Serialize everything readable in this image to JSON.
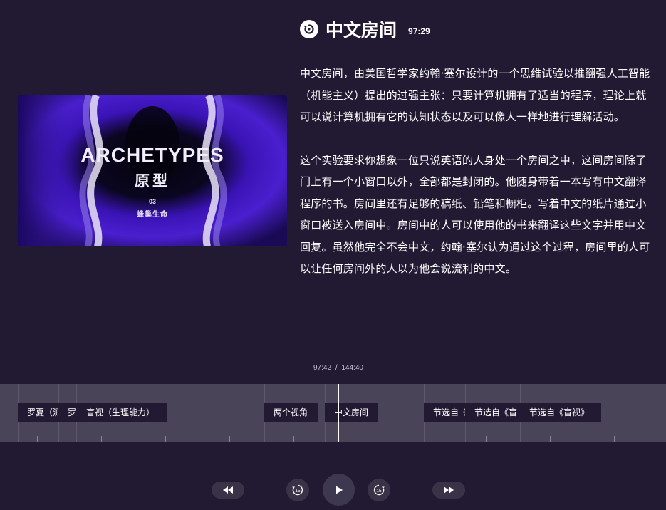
{
  "cover": {
    "title": "ARCHETYPES",
    "subtitle": "原型",
    "number": "03",
    "name": "蜂巢生命"
  },
  "header": {
    "title": "中文房间",
    "time": "97:29",
    "icon": "replay-icon"
  },
  "description": {
    "paragraph1": "中文房间，由美国哲学家约翰·塞尔设计的一个思维试验以推翻强人工智能（机能主义）提出的过强主张：只要计算机拥有了适当的程序，理论上就可以说计算机拥有它的认知状态以及可以像人一样地进行理解活动。",
    "paragraph2": "这个实验要求你想象一位只说英语的人身处一个房间之中，这间房间除了门上有一个小窗口以外，全部都是封闭的。他随身带着一本写有中文翻译程序的书。房间里还有足够的稿纸、铅笔和橱柜。写着中文的纸片通过小窗口被送入房间中。房间中的人可以使用他的书来翻译这些文字并用中文回复。虽然他完全不会中文，约翰·塞尔认为通过这个过程，房间里的人可以让任何房间外的人以为他会说流利的中文。"
  },
  "progress": {
    "current": "97:42",
    "separator": "/",
    "total": "144:40"
  },
  "timeline": {
    "chapters": [
      {
        "label": "罗夏（测"
      },
      {
        "label": "罗"
      },
      {
        "label": "盲视（生理能力）"
      },
      {
        "label": "两个视角"
      },
      {
        "label": "中文房间"
      },
      {
        "label": "节选自《"
      },
      {
        "label": "节选自《盲"
      },
      {
        "label": "节选自《盲视》"
      }
    ]
  },
  "controls": {
    "rewind_icon": "rewind-icon",
    "back15_icon": "skip-back-15-icon",
    "play_icon": "play-icon",
    "forward15_icon": "skip-forward-15-icon",
    "fastforward_icon": "fast-forward-icon",
    "back15_label": "15",
    "forward15_label": "15"
  },
  "colors": {
    "background": "#221a33",
    "timeline": "#4a4458",
    "cover_purple": "#3d12b8"
  }
}
